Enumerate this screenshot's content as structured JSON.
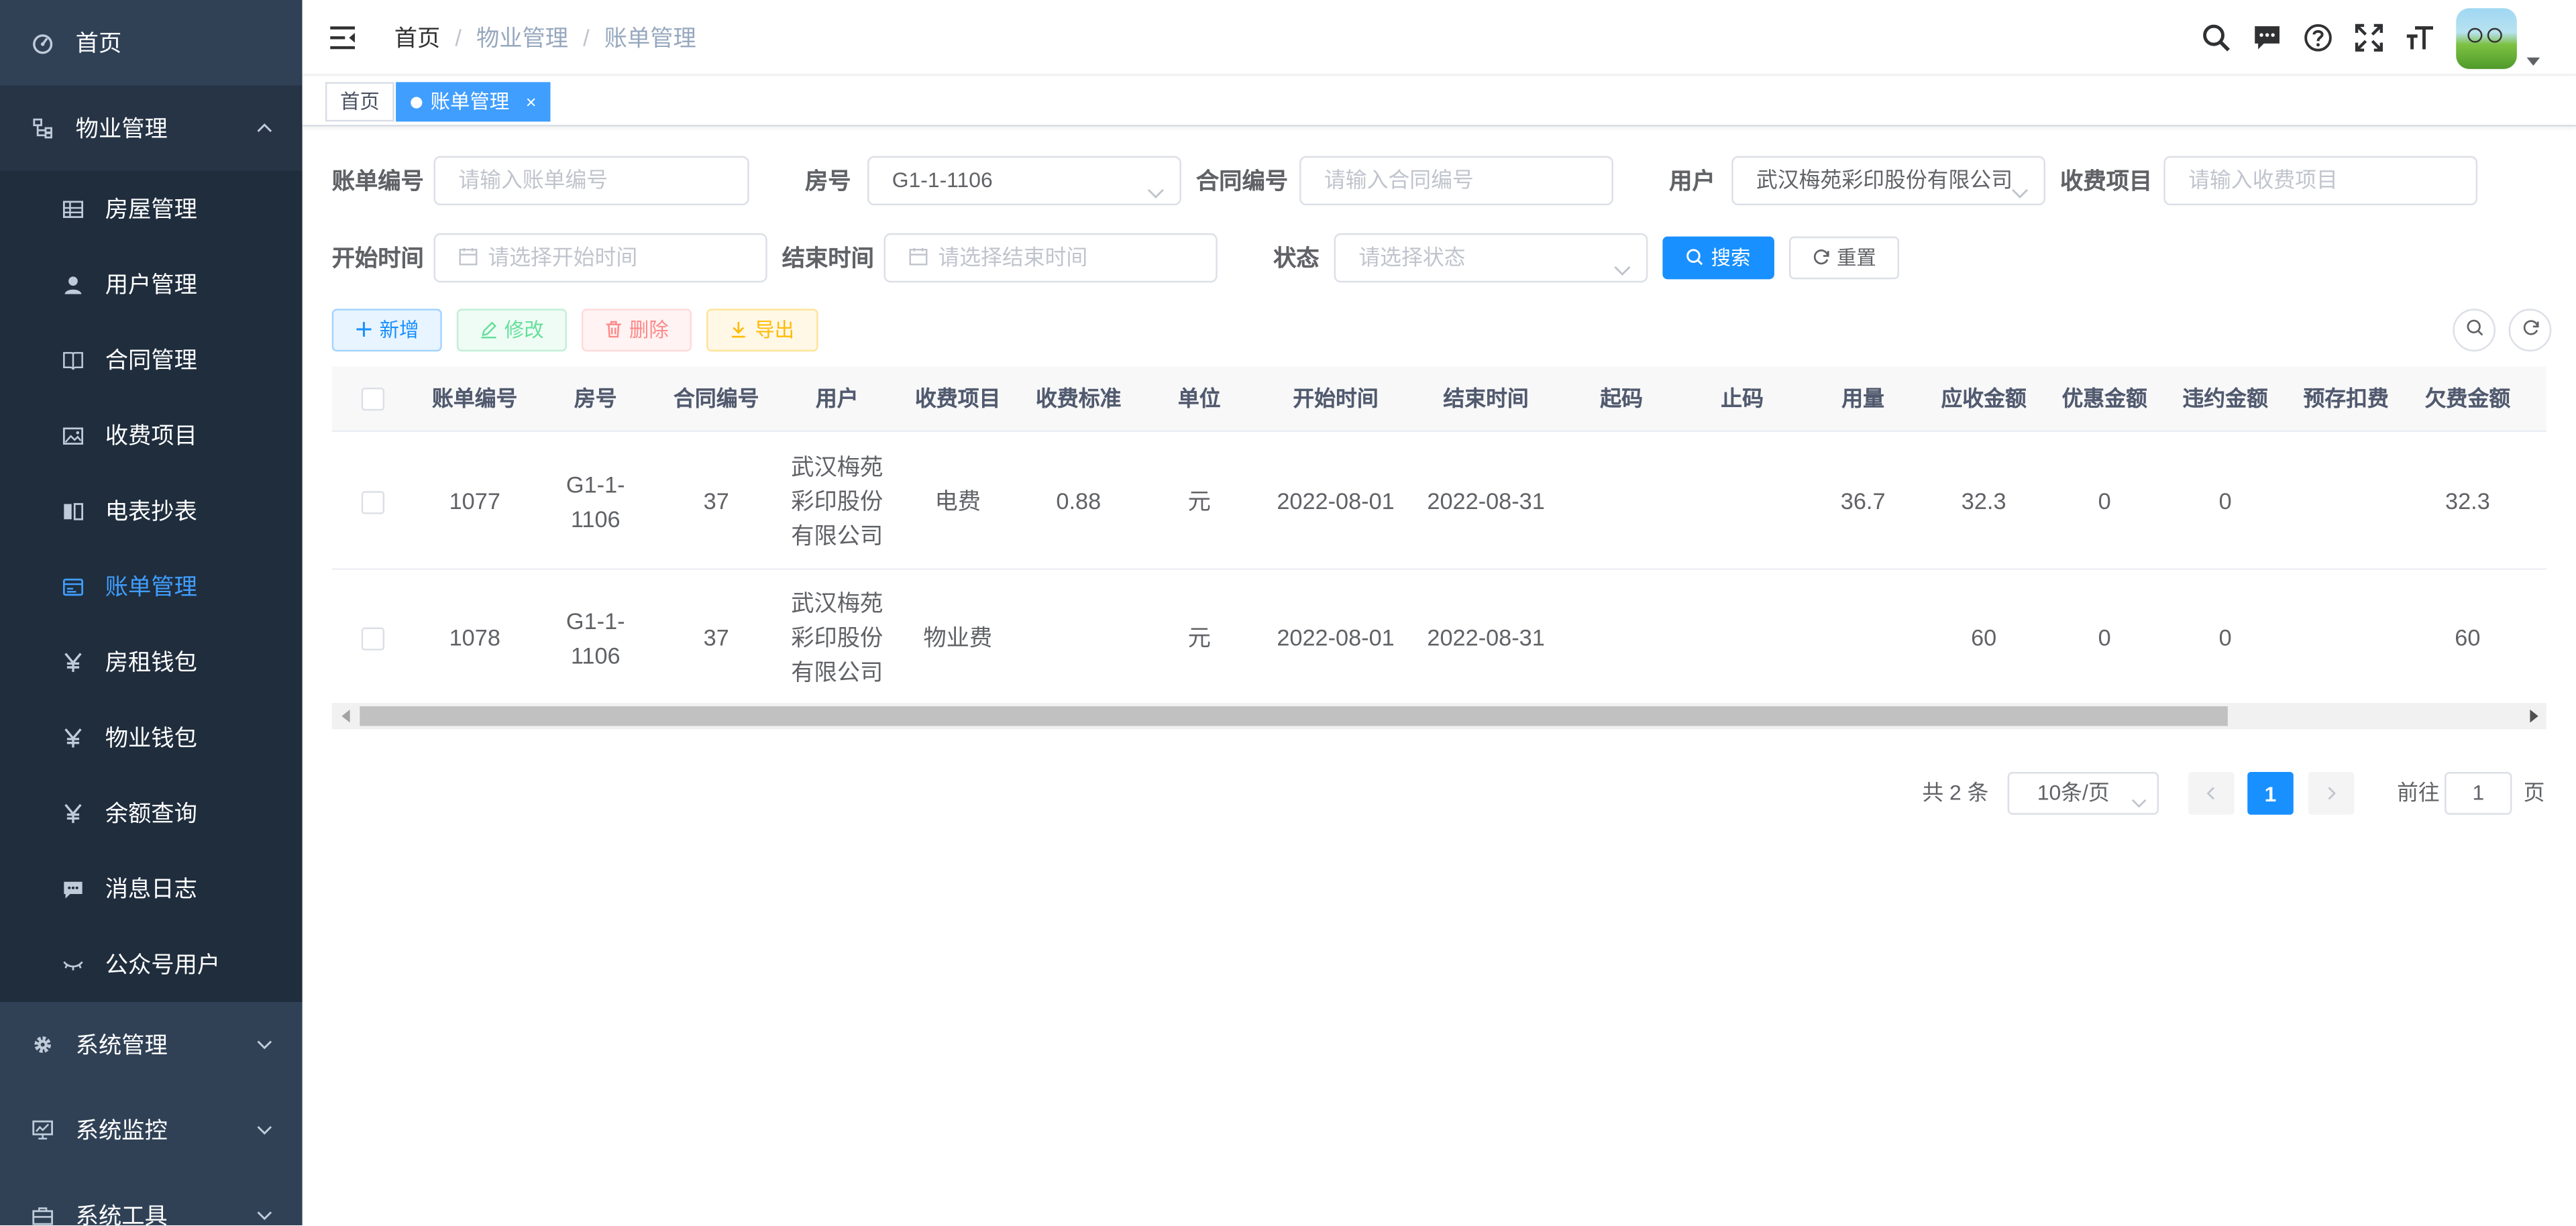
{
  "sidebar": {
    "home": "首页",
    "property_mgmt": "物业管理",
    "items": [
      {
        "label": "房屋管理",
        "icon": "table-icon"
      },
      {
        "label": "用户管理",
        "icon": "user-icon"
      },
      {
        "label": "合同管理",
        "icon": "book-icon"
      },
      {
        "label": "收费项目",
        "icon": "image-icon"
      },
      {
        "label": "电表抄表",
        "icon": "reading-icon"
      },
      {
        "label": "账单管理",
        "icon": "bill-icon"
      },
      {
        "label": "房租钱包",
        "icon": "yen-icon"
      },
      {
        "label": "物业钱包",
        "icon": "yen-icon"
      },
      {
        "label": "余额查询",
        "icon": "yen-icon"
      },
      {
        "label": "消息日志",
        "icon": "message-icon"
      },
      {
        "label": "公众号用户",
        "icon": "eye-closed-icon"
      }
    ],
    "system_mgmt": "系统管理",
    "system_monitor": "系统监控",
    "system_tools": "系统工具",
    "active_color": "#409eff",
    "bg_color": "#304156"
  },
  "navbar": {
    "breadcrumb": [
      "首页",
      "物业管理",
      "账单管理"
    ],
    "breadcrumb_sep": "/"
  },
  "tags": {
    "home": "首页",
    "active": "账单管理",
    "close": "×"
  },
  "search": {
    "bill_no_label": "账单编号",
    "bill_no_placeholder": "请输入账单编号",
    "room_label": "房号",
    "room_value": "G1-1-1106",
    "contract_label": "合同编号",
    "contract_placeholder": "请输入合同编号",
    "user_label": "用户",
    "user_value": "武汉梅苑彩印股份有限公司",
    "fee_label": "收费项目",
    "fee_placeholder": "请输入收费项目",
    "start_label": "开始时间",
    "start_placeholder": "请选择开始时间",
    "end_label": "结束时间",
    "end_placeholder": "请选择结束时间",
    "status_label": "状态",
    "status_placeholder": "请选择状态",
    "search_btn": "搜索",
    "reset_btn": "重置"
  },
  "toolbar": {
    "add": "新增",
    "edit": "修改",
    "delete": "删除",
    "export": "导出"
  },
  "table": {
    "columns": [
      "账单编号",
      "房号",
      "合同编号",
      "用户",
      "收费项目",
      "收费标准",
      "单位",
      "开始时间",
      "结束时间",
      "起码",
      "止码",
      "用量",
      "应收金额",
      "优惠金额",
      "违约金额",
      "预存扣费",
      "欠费金额"
    ],
    "rows": [
      [
        "1077",
        "G1-1-1106",
        "37",
        "武汉梅苑彩印股份有限公司",
        "电费",
        "0.88",
        "元",
        "2022-08-01",
        "2022-08-31",
        "",
        "",
        "36.7",
        "32.3",
        "0",
        "0",
        "",
        "32.3"
      ],
      [
        "1078",
        "G1-1-1106",
        "37",
        "武汉梅苑彩印股份有限公司",
        "物业费",
        "",
        "元",
        "2022-08-01",
        "2022-08-31",
        "",
        "",
        "",
        "60",
        "0",
        "0",
        "",
        "60"
      ]
    ]
  },
  "pagination": {
    "total": "共 2 条",
    "page_size": "10条/页",
    "current_page": "1",
    "goto_prefix": "前往",
    "goto_value": "1",
    "goto_suffix": "页"
  }
}
